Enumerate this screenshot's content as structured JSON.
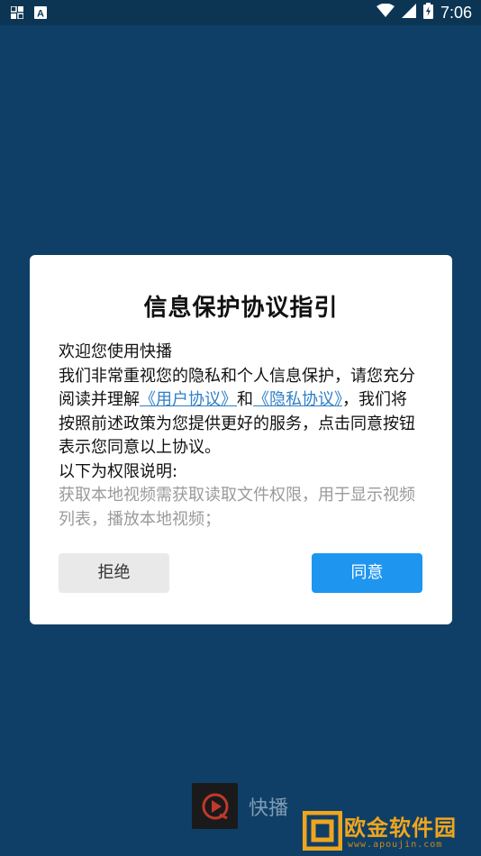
{
  "status_bar": {
    "time": "7:06",
    "left_icons": [
      "qr-grid-icon",
      "font-a-icon"
    ],
    "right_icons": [
      "wifi-icon",
      "cell-signal-icon",
      "battery-icon"
    ],
    "font_icon_letter": "A"
  },
  "dialog": {
    "title": "信息保护协议指引",
    "welcome": "欢迎您使用快播",
    "para_1_prefix": "我们非常重视您的隐私和个人信息保护，请您充分阅读并理解",
    "user_agreement_link": "《用户协议》",
    "and": "和",
    "privacy_link": "《隐私协议》",
    "para_1_suffix": "，我们将按照前述政策为您提供更好的服务，点击同意按钮表示您同意以上协议。",
    "permissions_heading": "以下为权限说明:",
    "permission_item": "获取本地视频需获取读取文件权限，用于显示视频列表，播放本地视频；",
    "refuse_label": "拒绝",
    "agree_label": "同意"
  },
  "brand": {
    "name": "快播"
  },
  "watermark": {
    "text": "欧金软件园",
    "url": "www.apoujin.com"
  },
  "colors": {
    "background": "#0f3f66",
    "agree_button": "#1e96f0",
    "link": "#2f7fc7",
    "watermark": "#f0a51e"
  }
}
